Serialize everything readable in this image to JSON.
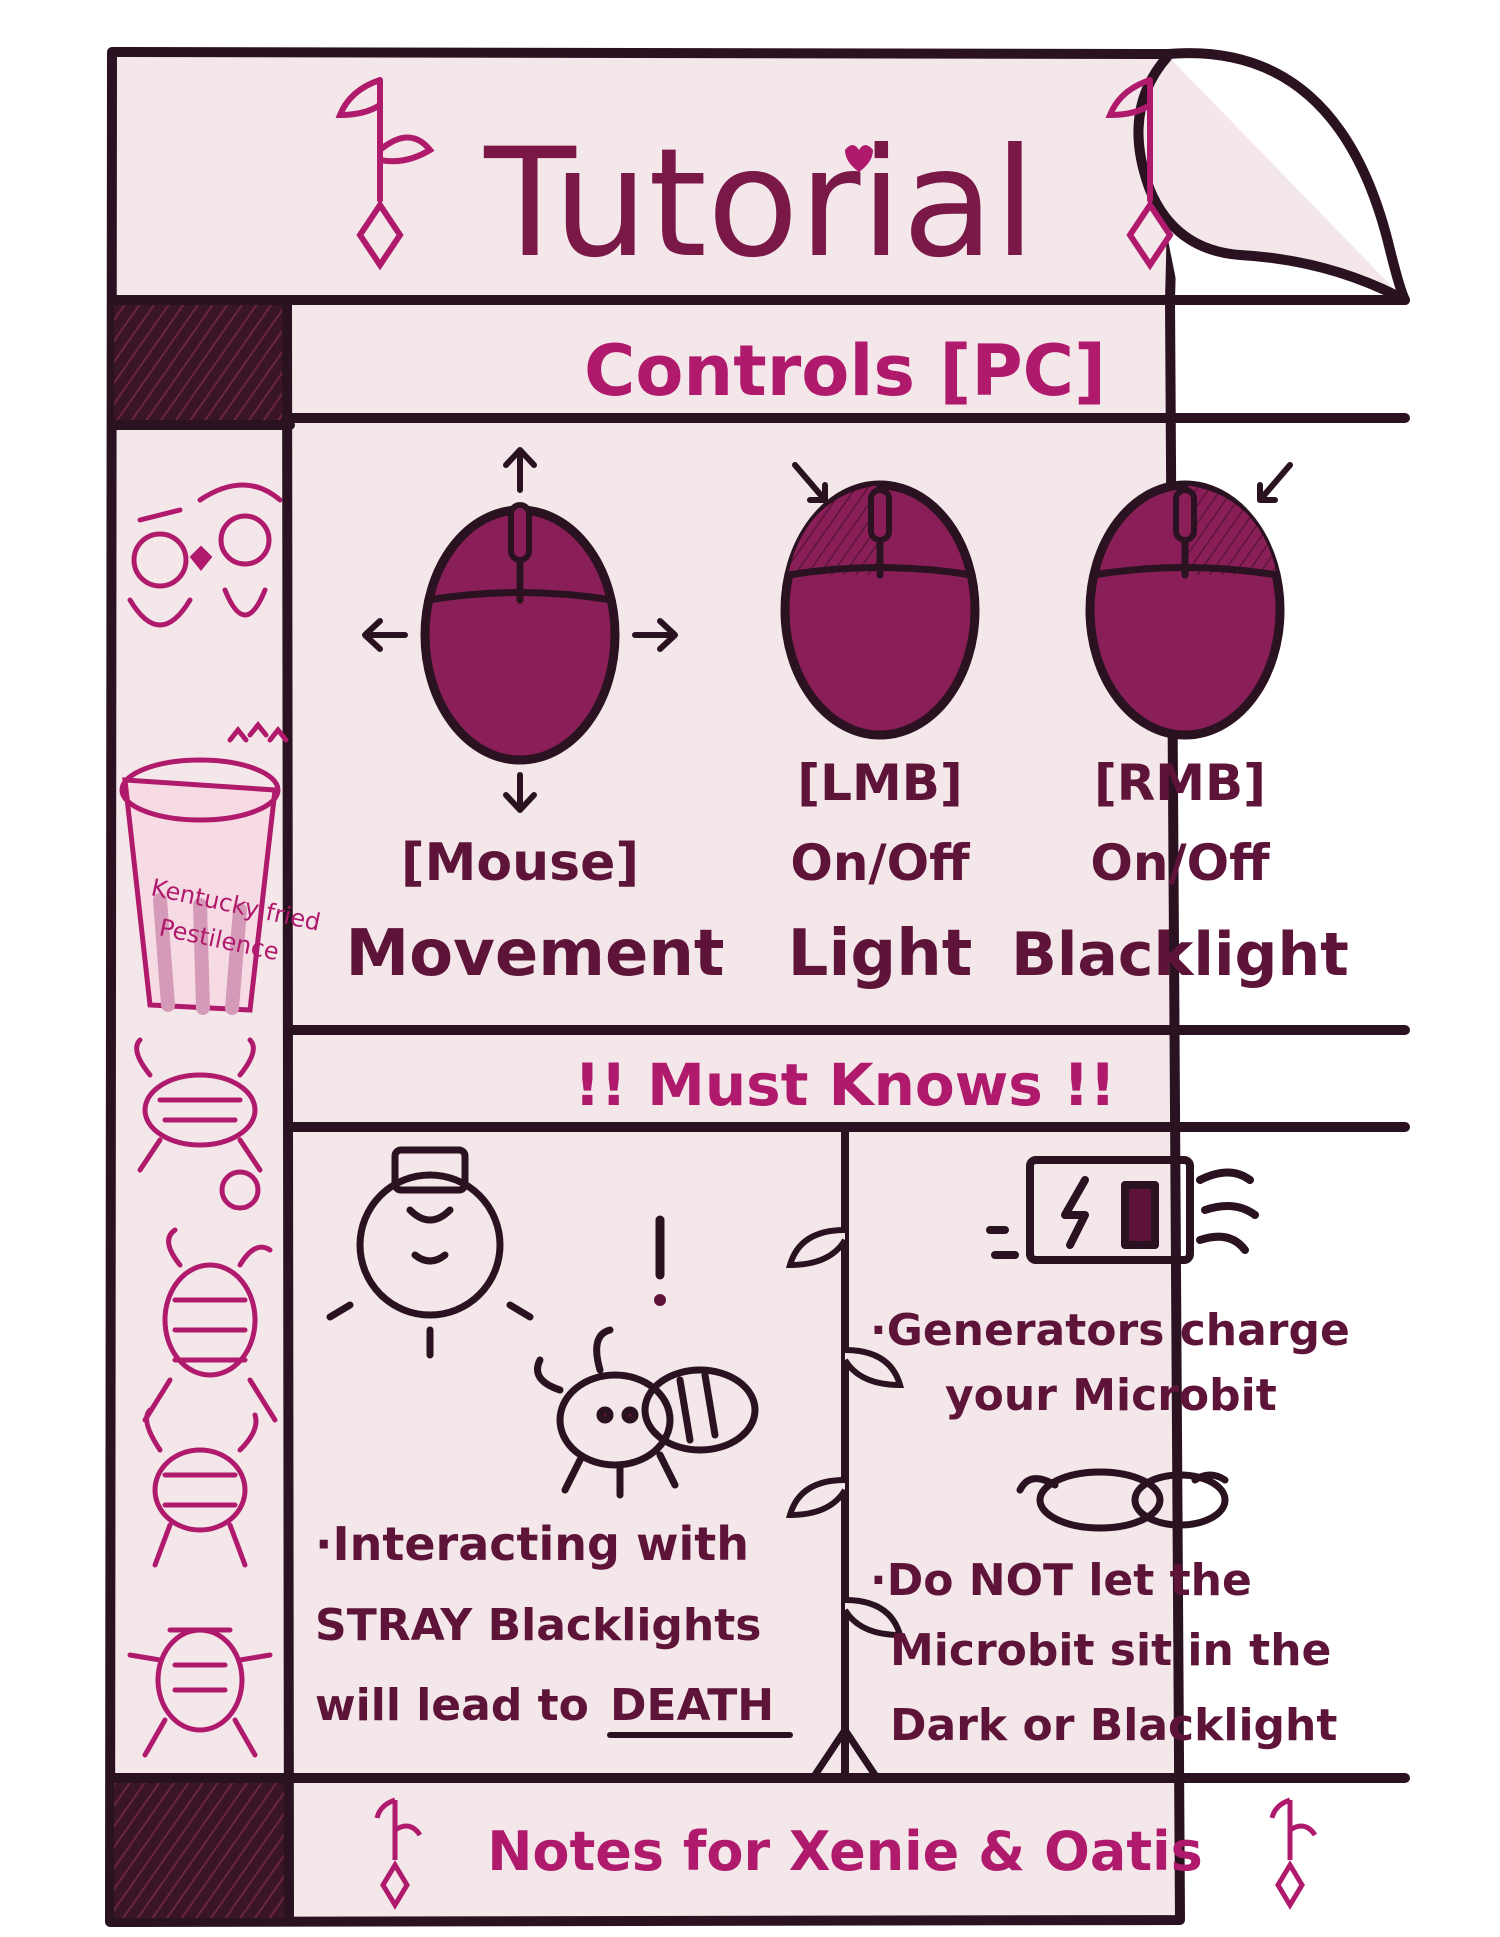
{
  "title": "Tutorial",
  "controls": {
    "heading": "Controls [PC]",
    "items": [
      {
        "key": "[Mouse]",
        "state": "",
        "action": "Movement"
      },
      {
        "key": "[LMB]",
        "state": "On/Off",
        "action": "Light"
      },
      {
        "key": "[RMB]",
        "state": "On/Off",
        "action": "Blacklight"
      }
    ]
  },
  "must_knows": {
    "heading": "!! Must Knows !!",
    "left_tip": [
      "·Interacting with",
      "STRAY Blacklights",
      "will lead to",
      "DEATH"
    ],
    "right_tip_1": [
      "·Generators charge",
      "your Microbit"
    ],
    "right_tip_2": [
      "·Do NOT let the",
      "Microbit sit in the",
      "Dark or Blacklight"
    ]
  },
  "sidebar": {
    "bucket_text": [
      "Kentucky fried",
      "Pestilence"
    ]
  },
  "footer": "Notes for Xenie & Oatis",
  "colors": {
    "paper": "#f4e7ea",
    "ink": "#2a1220",
    "magenta": "#b01a6c",
    "plum": "#5e1438",
    "mouse": "#8a1e58"
  },
  "icons": [
    "bookmark-charm-icon",
    "mouse-icon",
    "arrow-icon",
    "lightbulb-icon",
    "bug-icon",
    "battery-icon",
    "vine-icon",
    "fried-chicken-bucket-icon"
  ]
}
